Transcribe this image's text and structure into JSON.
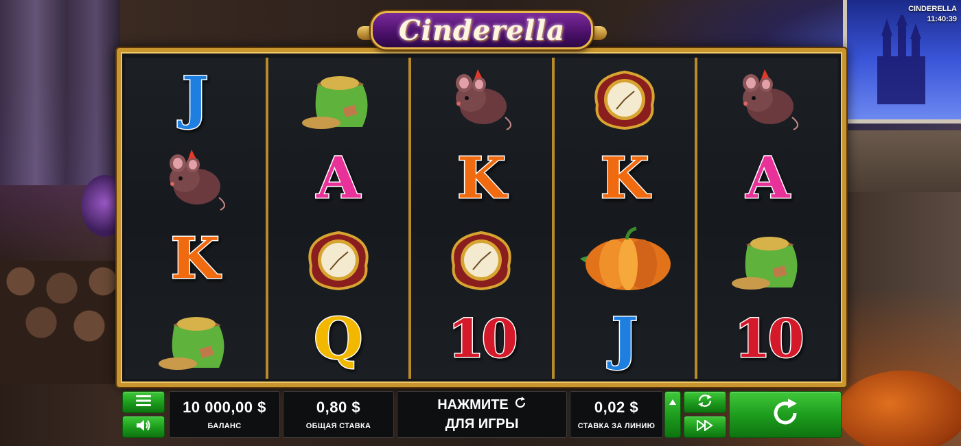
{
  "game": {
    "title": "Cinderella",
    "corner_name": "CINDERELLA",
    "clock": "11:40:39"
  },
  "reels": [
    [
      "J",
      "mouse",
      "K",
      "grain-sack"
    ],
    [
      "grain-sack",
      "A",
      "clock",
      "Q"
    ],
    [
      "mouse",
      "K",
      "clock",
      "10"
    ],
    [
      "clock",
      "K",
      "pumpkin",
      "J"
    ],
    [
      "mouse",
      "A",
      "grain-sack",
      "10"
    ]
  ],
  "controls": {
    "balance_value": "10 000,00 $",
    "balance_label": "БАЛАНС",
    "total_bet_value": "0,80 $",
    "total_bet_label": "ОБЩАЯ СТАВКА",
    "press_line1": "НАЖМИТЕ",
    "press_line2": "ДЛЯ ИГРЫ",
    "line_bet_value": "0,02 $",
    "line_bet_label": "СТАВКА ЗА ЛИНИЮ",
    "menu_icon": "hamburger-icon",
    "sound_icon": "speaker-icon",
    "autoplay_icon": "autoplay-icon",
    "turbo_icon": "fast-forward-icon",
    "spin_icon": "spin-arrow-icon",
    "bet_up_icon": "triangle-up-icon"
  },
  "colors": {
    "frame_gold": "#c8952f",
    "button_green": "#1c9a1c",
    "title_purple": "#4a1068"
  }
}
